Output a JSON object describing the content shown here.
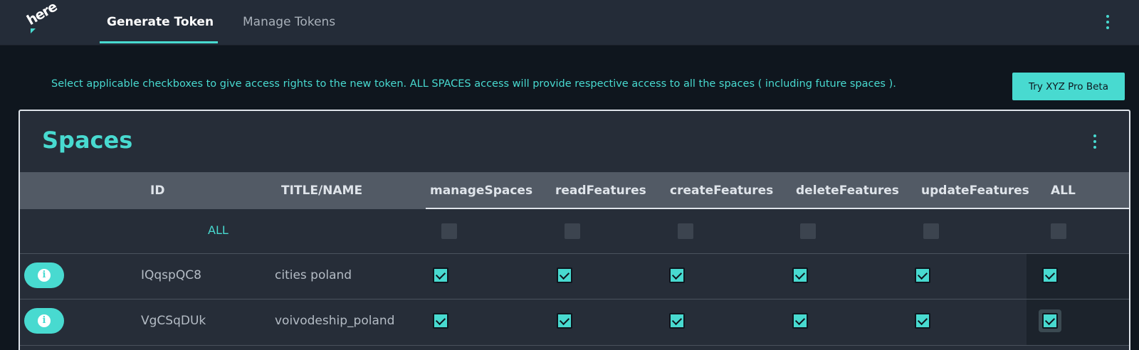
{
  "header": {
    "logo_text": "here",
    "tabs": [
      {
        "label": "Generate Token",
        "active": true
      },
      {
        "label": "Manage Tokens",
        "active": false
      }
    ],
    "menu_icon": "kebab-menu-icon"
  },
  "info": {
    "message": "Select applicable checkboxes to give access rights to the new token. ALL SPACES access will provide respective access to all the spaces ( including future spaces ).",
    "pro_button_label": "Try XYZ Pro Beta"
  },
  "spaces": {
    "title": "Spaces",
    "menu_icon": "kebab-menu-icon",
    "columns": [
      "ID",
      "TITLE/NAME",
      "manageSpaces",
      "readFeatures",
      "createFeatures",
      "deleteFeatures",
      "updateFeatures",
      "ALL"
    ],
    "all_row": {
      "label": "ALL",
      "checks": [
        false,
        false,
        false,
        false,
        false,
        false
      ]
    },
    "rows": [
      {
        "id": "IQqspQC8",
        "title": "cities poland",
        "checks": [
          true,
          true,
          true,
          true,
          true,
          true
        ]
      },
      {
        "id": "VgCSqDUk",
        "title": "voivodeship_poland",
        "checks": [
          true,
          true,
          true,
          true,
          true,
          true
        ]
      }
    ]
  },
  "colors": {
    "accent": "#48dad0",
    "background": "#0f161e",
    "topbar": "#242c38",
    "card": "#262d38",
    "table_header": "#525a65"
  }
}
